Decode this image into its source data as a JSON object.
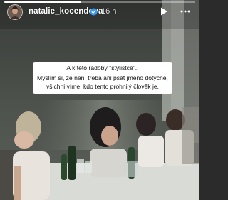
{
  "story": {
    "progress_fraction": 0.4,
    "accent_color": "#ffffff"
  },
  "header": {
    "username": "natalie_kocendova",
    "verified_icon": "verified-badge-icon",
    "timestamp": "16 h",
    "play_icon": "play-icon",
    "more_icon": "more-options-icon"
  },
  "caption": {
    "line1": "A k této rádoby \"stylistce\"..",
    "line2": "Myslím si, že není třeba ani psát jméno dotyčné,",
    "line3": "všichni víme, kdo tento prohnilý člověk je."
  }
}
